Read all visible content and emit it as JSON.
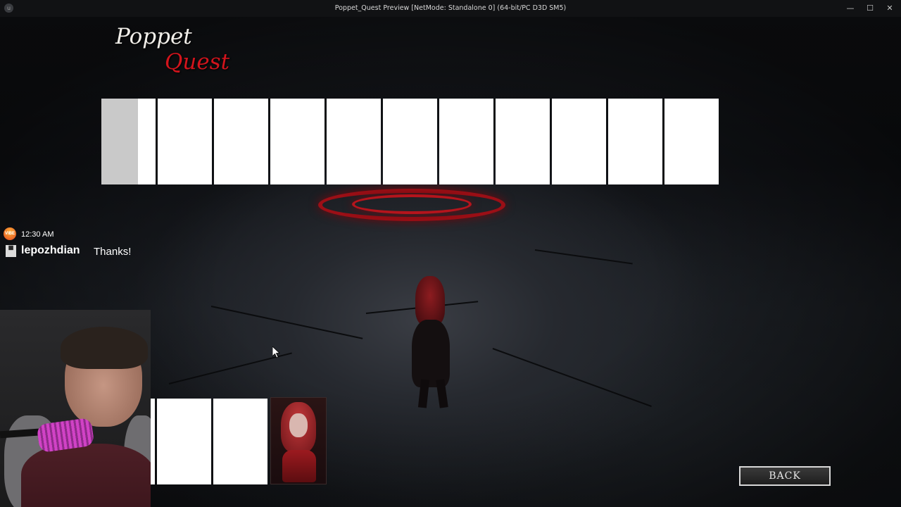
{
  "window": {
    "title": "Poppet_Quest Preview [NetMode: Standalone 0]  (64-bit/PC D3D SM5)",
    "minimize_glyph": "—",
    "maximize_glyph": "☐",
    "close_glyph": "✕"
  },
  "game": {
    "logo_line1": "Poppet",
    "logo_line2": "Quest",
    "back_label": "BACK",
    "top_slot_count": 11,
    "bottom_slot_count": 2
  },
  "stream_overlay": {
    "chat": {
      "badge": "VIBE",
      "time": "12:30 AM",
      "username": "lepozhdian",
      "message": "Thanks!"
    }
  },
  "colors": {
    "logo_white": "#f1eee9",
    "logo_red": "#d2141c",
    "portal_red": "#9b0f16",
    "slot_white": "#ffffff"
  }
}
